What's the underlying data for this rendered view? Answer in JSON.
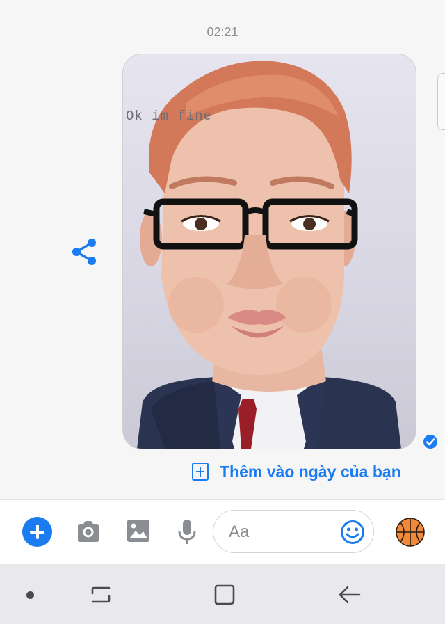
{
  "chat": {
    "timestamp": "02:21",
    "video_caption": "Ok im fine",
    "add_story_label": "Thêm vào ngày của bạn"
  },
  "composer": {
    "input_placeholder": "Aa",
    "input_value": ""
  },
  "icons": {
    "share": "share-icon",
    "seen": "seen-check-icon",
    "add_story": "add-square-icon",
    "plus": "plus-icon",
    "camera": "camera-icon",
    "gallery": "image-icon",
    "mic": "microphone-icon",
    "emoji": "smiley-icon",
    "quick_reaction": "basketball-icon",
    "nav_recents": "recents-icon",
    "nav_home": "home-icon",
    "nav_back": "back-icon"
  },
  "colors": {
    "accent": "#1a7cf0",
    "background": "#f6f6f7",
    "navbar": "#e9e9ec"
  }
}
